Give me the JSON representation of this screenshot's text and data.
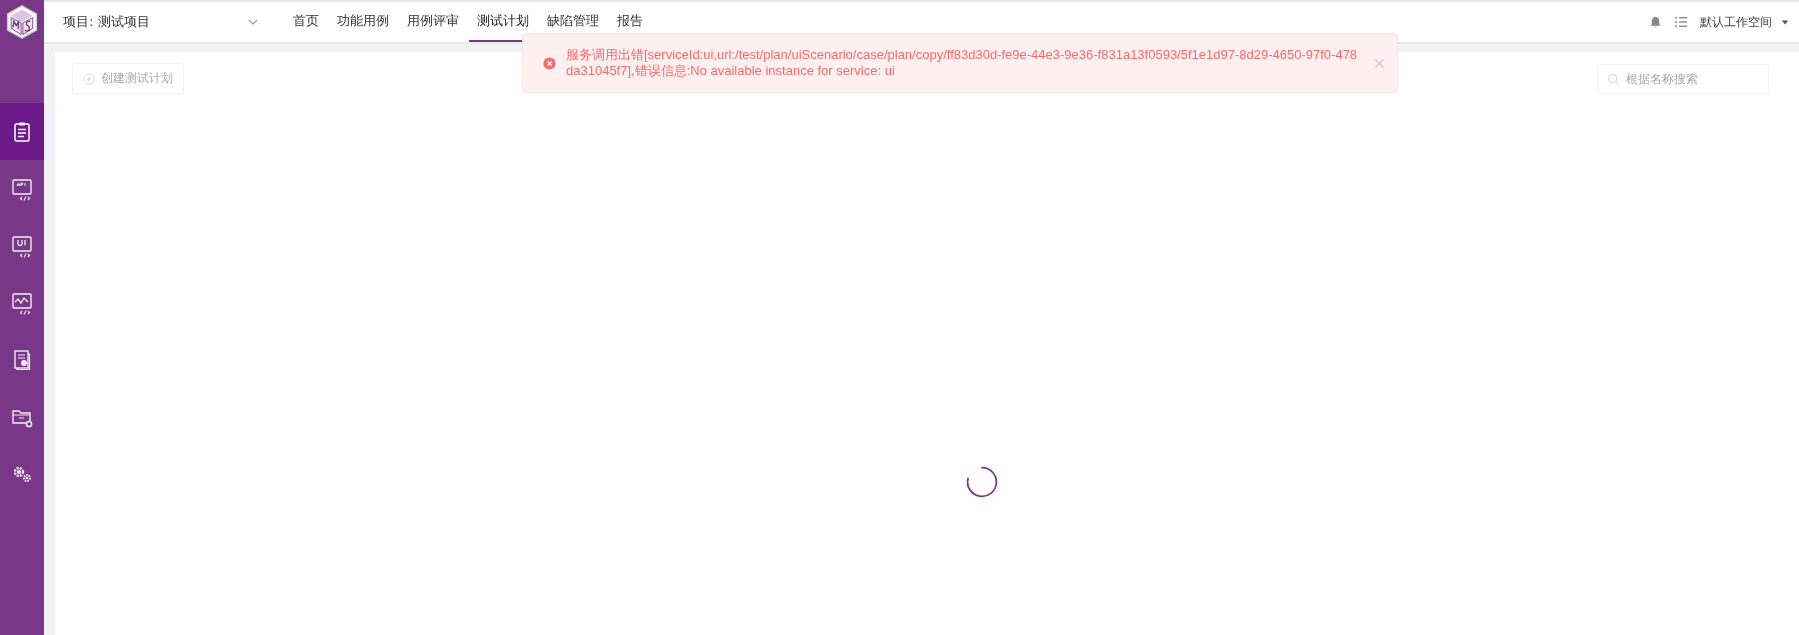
{
  "header": {
    "project": "项目: 测试项目",
    "tabs": [
      {
        "label": "首页",
        "selected": false
      },
      {
        "label": "功能用例",
        "selected": false
      },
      {
        "label": "用例评审",
        "selected": false
      },
      {
        "label": "测试计划",
        "selected": true
      },
      {
        "label": "缺陷管理",
        "selected": false
      },
      {
        "label": "报告",
        "selected": false
      }
    ],
    "workspace": "默认工作空间"
  },
  "sidebar": {
    "items": [
      {
        "kind": "plan",
        "selected": true
      },
      {
        "kind": "api",
        "selected": false
      },
      {
        "kind": "ui",
        "selected": false
      },
      {
        "kind": "perf",
        "selected": false
      },
      {
        "kind": "report",
        "selected": false
      },
      {
        "kind": "folder",
        "selected": false
      },
      {
        "kind": "settings",
        "selected": false
      }
    ]
  },
  "toolbar": {
    "create_button": "创建测试计划",
    "search": {
      "placeholder": "根据名称搜索"
    }
  },
  "loading": true,
  "toast": {
    "kind": "error",
    "message": "服务调用出错[serviceId:ui,url:/test/plan/uiScenario/case/plan/copy/ff83d30d-fe9e-44e3-9e36-f831a13f0593/5f1e1d97-8d29-4650-97f0-478da31045f7],错误信息:No available instance for service: ui"
  }
}
